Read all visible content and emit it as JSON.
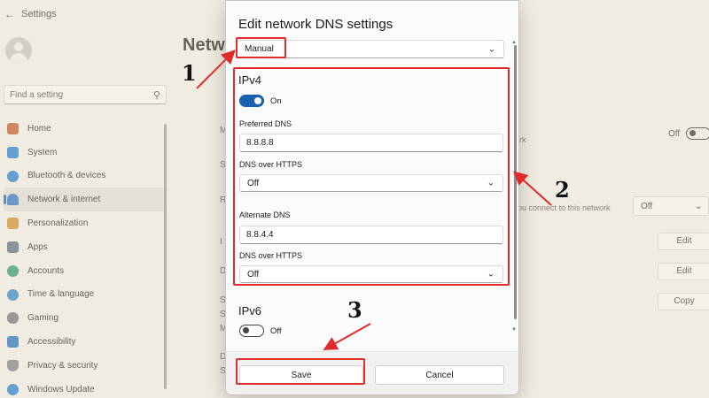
{
  "window": {
    "title": "Settings"
  },
  "sidebar": {
    "search_placeholder": "Find a setting",
    "items": [
      {
        "label": "Home",
        "icon": "home-icon",
        "color": "#c2592a"
      },
      {
        "label": "System",
        "icon": "system-icon",
        "color": "#1f7fd4"
      },
      {
        "label": "Bluetooth & devices",
        "icon": "bluetooth-icon",
        "color": "#1f7fd4"
      },
      {
        "label": "Network & internet",
        "icon": "wifi-icon",
        "color": "#2d72c9",
        "active": true
      },
      {
        "label": "Personalization",
        "icon": "paint-brush-icon",
        "color": "#d08a2a"
      },
      {
        "label": "Apps",
        "icon": "apps-icon",
        "color": "#5a6b80"
      },
      {
        "label": "Accounts",
        "icon": "accounts-icon",
        "color": "#2a9a6c"
      },
      {
        "label": "Time & language",
        "icon": "globe-clock-icon",
        "color": "#2a86c9"
      },
      {
        "label": "Gaming",
        "icon": "gamepad-icon",
        "color": "#6f7377"
      },
      {
        "label": "Accessibility",
        "icon": "accessibility-icon",
        "color": "#1f6fc0"
      },
      {
        "label": "Privacy & security",
        "icon": "shield-icon",
        "color": "#7a7f86"
      },
      {
        "label": "Windows Update",
        "icon": "update-icon",
        "color": "#1f7fd4"
      }
    ]
  },
  "background": {
    "page_title": "Netw",
    "row_letters": [
      "M",
      "S",
      "R",
      "I",
      "D",
      "S",
      "S",
      "M",
      "D",
      "S"
    ],
    "metered_toggle_label": "Off",
    "right_texts": [
      "rk",
      "ou connect to this network"
    ],
    "select_value": "Off",
    "edit_label_1": "Edit",
    "edit_label_2": "Edit",
    "copy_label": "Copy"
  },
  "dialog": {
    "title": "Edit network DNS settings",
    "mode_value": "Manual",
    "ipv4": {
      "heading": "IPv4",
      "toggle_label": "On",
      "preferred_label": "Preferred DNS",
      "preferred_value": "8.8.8.8",
      "doh_label_1": "DNS over HTTPS",
      "doh_value_1": "Off",
      "alternate_label": "Alternate DNS",
      "alternate_value": "8.8.4.4",
      "doh_label_2": "DNS over HTTPS",
      "doh_value_2": "Off"
    },
    "ipv6": {
      "heading": "IPv6",
      "toggle_label": "Off"
    },
    "save_label": "Save",
    "cancel_label": "Cancel"
  },
  "annotations": {
    "step1": "1",
    "step2": "2",
    "step3": "3",
    "color": "#e02b2b"
  }
}
